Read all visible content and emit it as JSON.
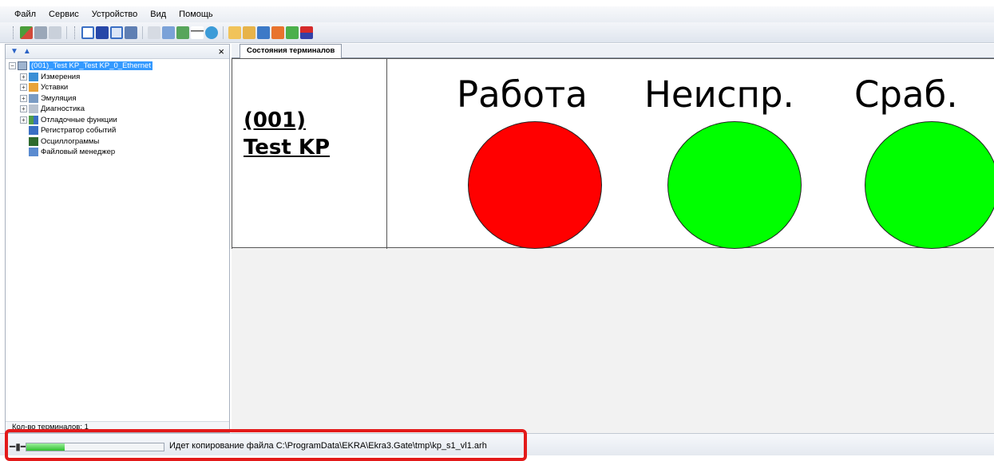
{
  "menu": [
    "Файл",
    "Сервис",
    "Устройство",
    "Вид",
    "Помощь"
  ],
  "tree": {
    "root_label": "(001)_Test KP_Test KP_0_Ethernet",
    "items": [
      "Измерения",
      "Уставки",
      "Эмуляция",
      "Диагностика",
      "Отладочные функции",
      "Регистратор событий",
      "Осциллограммы",
      "Файловый менеджер"
    ],
    "footer": "Кол-во терминалов: 1"
  },
  "tab": {
    "label": "Состояния терминалов"
  },
  "terminal": {
    "id": "(001)",
    "name": "Test KP"
  },
  "indicators": [
    {
      "label": "Работа",
      "color": "#ff0000"
    },
    {
      "label": "Неиспр.",
      "color": "#00ff00"
    },
    {
      "label": "Сраб.",
      "color": "#00ff00"
    }
  ],
  "status": {
    "progress": 0.28,
    "message": "Идет копирование файла C:\\ProgramData\\EKRA\\Ekra3.Gate\\tmp\\kp_s1_vl1.arh"
  },
  "colors": {
    "highlight": "#e31a1a",
    "selection": "#3399ff"
  }
}
